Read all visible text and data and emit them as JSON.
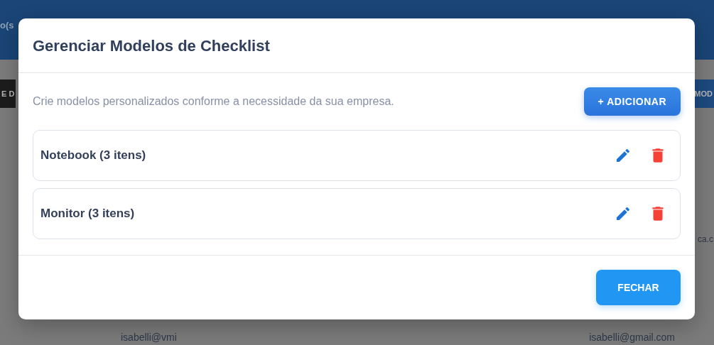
{
  "background": {
    "header_text": "o(s",
    "left_tab": "E D",
    "right_tab": "MOD",
    "row_text": "ca.c",
    "emails": [
      "isabelli@vmi",
      "isabelli@gmail.com"
    ]
  },
  "dialog": {
    "title": "Gerenciar Modelos de Checklist",
    "description": "Crie modelos personalizados conforme a necessidade da sua empresa.",
    "add_button": "+ ADICIONAR",
    "models": [
      {
        "name": "Notebook (3 itens)"
      },
      {
        "name": "Monitor (3 itens)"
      }
    ],
    "close_button": "FECHAR"
  }
}
